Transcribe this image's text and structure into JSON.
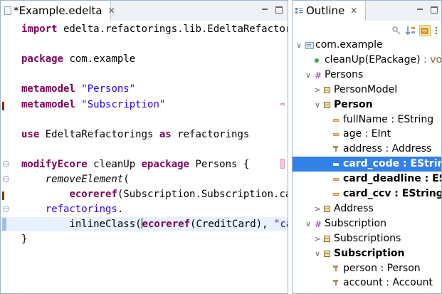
{
  "editor": {
    "tab_title": "*Example.edelta",
    "close_glyph": "✕",
    "lines": [
      {
        "parts": [
          {
            "t": "import",
            "c": "kw"
          },
          {
            "t": " edelta.refactorings.lib.EdeltaRefactorings",
            "c": ""
          }
        ]
      },
      {
        "parts": []
      },
      {
        "parts": [
          {
            "t": "package",
            "c": "kw"
          },
          {
            "t": " com.example",
            "c": ""
          }
        ]
      },
      {
        "parts": []
      },
      {
        "parts": [
          {
            "t": "metamodel",
            "c": "kw"
          },
          {
            "t": " ",
            "c": ""
          },
          {
            "t": "\"Persons\"",
            "c": "str"
          }
        ]
      },
      {
        "parts": [
          {
            "t": "metamodel",
            "c": "kw"
          },
          {
            "t": " ",
            "c": ""
          },
          {
            "t": "\"Subscription\"",
            "c": "str"
          }
        ]
      },
      {
        "parts": []
      },
      {
        "parts": [
          {
            "t": "use",
            "c": "kw"
          },
          {
            "t": " EdeltaRefactorings ",
            "c": ""
          },
          {
            "t": "as",
            "c": "kw"
          },
          {
            "t": " refactorings",
            "c": ""
          }
        ]
      },
      {
        "parts": []
      },
      {
        "parts": [
          {
            "t": "modifyEcore",
            "c": "kw"
          },
          {
            "t": " cleanUp ",
            "c": ""
          },
          {
            "t": "epackage",
            "c": "kw"
          },
          {
            "t": " Persons {",
            "c": ""
          }
        ]
      },
      {
        "parts": [
          {
            "t": "    ",
            "c": ""
          },
          {
            "t": "removeElement",
            "c": "it"
          },
          {
            "t": "(",
            "c": ""
          }
        ]
      },
      {
        "parts": [
          {
            "t": "        ",
            "c": ""
          },
          {
            "t": "ecoreref",
            "c": "kw"
          },
          {
            "t": "(Subscription.Subscription.card))",
            "c": ""
          }
        ]
      },
      {
        "parts": [
          {
            "t": "    ",
            "c": ""
          },
          {
            "t": "refactorings",
            "c": "str"
          },
          {
            "t": ".",
            "c": ""
          }
        ]
      },
      {
        "parts": [
          {
            "t": "        inlineClass(",
            "c": ""
          },
          {
            "t": "ecoreref",
            "c": "kw"
          },
          {
            "t": "(CreditCard), ",
            "c": ""
          },
          {
            "t": "\"card_\"",
            "c": "str"
          },
          {
            "t": ")",
            "c": ""
          }
        ]
      },
      {
        "parts": [
          {
            "t": "}",
            "c": ""
          }
        ]
      }
    ]
  },
  "outline": {
    "tab_title": "Outline",
    "close_glyph": "✕",
    "nodes": [
      {
        "label": "com.example",
        "type": "",
        "twisty": "∨",
        "icon": "package",
        "bold": false,
        "selected": false
      },
      {
        "label": "cleanUp(EPackage)",
        "type": " : void",
        "twisty": "",
        "icon": "operation",
        "bold": false,
        "selected": false
      },
      {
        "label": "Persons",
        "type": "",
        "twisty": "∨",
        "icon": "epackage",
        "bold": false,
        "selected": false
      },
      {
        "label": "PersonModel",
        "type": "",
        "twisty": ">",
        "icon": "class",
        "bold": false,
        "selected": false
      },
      {
        "label": "Person",
        "type": "",
        "twisty": "∨",
        "icon": "class",
        "bold": true,
        "selected": false
      },
      {
        "label": "fullName",
        "type": " : EString",
        "twisty": "",
        "icon": "attribute",
        "bold": false,
        "selected": false
      },
      {
        "label": "age",
        "type": " : EInt",
        "twisty": "",
        "icon": "attribute",
        "bold": false,
        "selected": false
      },
      {
        "label": "address",
        "type": " : Address",
        "twisty": "",
        "icon": "reference",
        "bold": false,
        "selected": false
      },
      {
        "label": "card_code",
        "type": " : EString",
        "twisty": "",
        "icon": "attribute",
        "bold": true,
        "selected": true
      },
      {
        "label": "card_deadline",
        "type": " : EString",
        "twisty": "",
        "icon": "attribute",
        "bold": true,
        "selected": false
      },
      {
        "label": "card_ccv",
        "type": " : EString",
        "twisty": "",
        "icon": "attribute",
        "bold": true,
        "selected": false
      },
      {
        "label": "Address",
        "type": "",
        "twisty": ">",
        "icon": "class",
        "bold": false,
        "selected": false
      },
      {
        "label": "Subscription",
        "type": "",
        "twisty": "∨",
        "icon": "epackage",
        "bold": false,
        "selected": false
      },
      {
        "label": "Subscriptions",
        "type": "",
        "twisty": ">",
        "icon": "class",
        "bold": false,
        "selected": false
      },
      {
        "label": "Subscription",
        "type": "",
        "twisty": "∨",
        "icon": "class",
        "bold": true,
        "selected": false
      },
      {
        "label": "person",
        "type": " : Person",
        "twisty": "",
        "icon": "reference",
        "bold": false,
        "selected": false
      },
      {
        "label": "account",
        "type": " : Account",
        "twisty": "",
        "icon": "reference",
        "bold": false,
        "selected": false
      }
    ]
  },
  "colors": {
    "keyword": "#7f0055",
    "string": "#2a00ff",
    "selection": "#3380e6",
    "current_line": "#e8f2fe"
  }
}
